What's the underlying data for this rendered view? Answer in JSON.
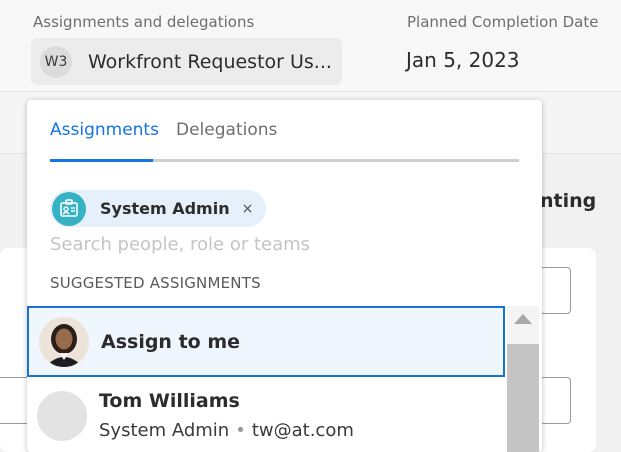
{
  "header": {
    "assignments_label": "Assignments and delegations",
    "assignee_initials": "W3",
    "assignee_name": "Workfront Requestor Us...",
    "date_label": "Planned Completion Date",
    "date_value": "Jan 5, 2023"
  },
  "background": {
    "partial_heading": "nting"
  },
  "popover": {
    "tabs": [
      {
        "label": "Assignments",
        "active": true
      },
      {
        "label": "Delegations",
        "active": false
      }
    ],
    "chip": {
      "label": "System Admin",
      "remove_glyph": "×",
      "icon": "role-badge-icon"
    },
    "search": {
      "value": "",
      "placeholder": "Search people, role or teams"
    },
    "section_title": "SUGGESTED ASSIGNMENTS",
    "items": [
      {
        "name": "Assign to me",
        "icon": "user-photo-avatar"
      },
      {
        "name": "Tom Williams",
        "role": "System Admin",
        "separator": "•",
        "email": "tw@at.com"
      }
    ]
  },
  "colors": {
    "accent": "#1473e6",
    "chip_bg": "#e6f0fa",
    "role_icon": "#36b2c4",
    "selected_border": "#1a72d0"
  }
}
